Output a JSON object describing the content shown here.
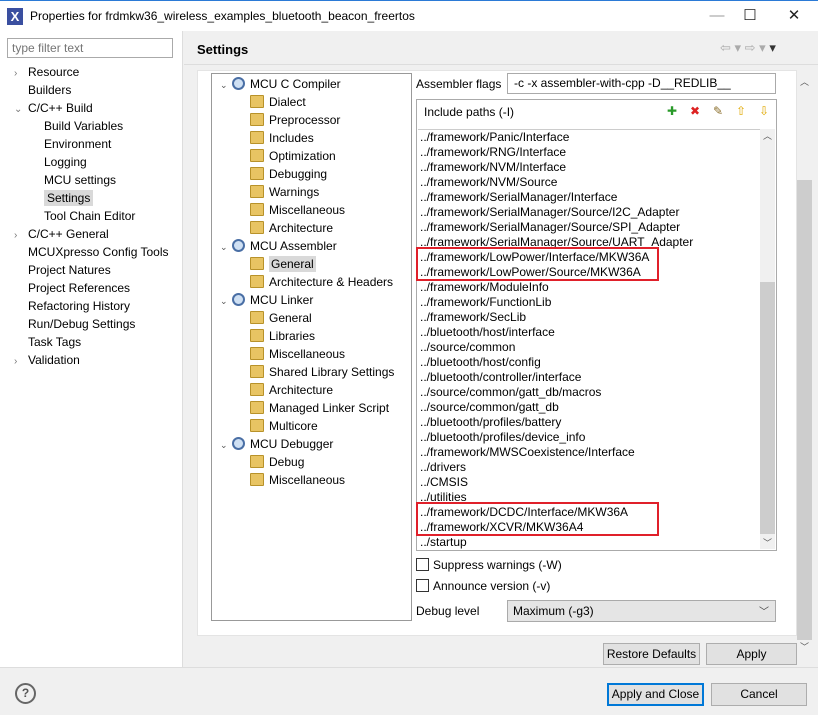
{
  "window": {
    "title": "Properties for frdmkw36_wireless_examples_bluetooth_beacon_freertos",
    "icon": "eclipse-x-icon"
  },
  "filter": {
    "placeholder": "type filter text"
  },
  "nav": [
    {
      "label": "Resource",
      "level": 0,
      "expander": "closed"
    },
    {
      "label": "Builders",
      "level": 0
    },
    {
      "label": "C/C++ Build",
      "level": 0,
      "expander": "open"
    },
    {
      "label": "Build Variables",
      "level": 1
    },
    {
      "label": "Environment",
      "level": 1
    },
    {
      "label": "Logging",
      "level": 1
    },
    {
      "label": "MCU settings",
      "level": 1
    },
    {
      "label": "Settings",
      "level": 1,
      "selected": true
    },
    {
      "label": "Tool Chain Editor",
      "level": 1
    },
    {
      "label": "C/C++ General",
      "level": 0,
      "expander": "closed"
    },
    {
      "label": "MCUXpresso Config Tools",
      "level": 0
    },
    {
      "label": "Project Natures",
      "level": 0
    },
    {
      "label": "Project References",
      "level": 0
    },
    {
      "label": "Refactoring History",
      "level": 0
    },
    {
      "label": "Run/Debug Settings",
      "level": 0
    },
    {
      "label": "Task Tags",
      "level": 0
    },
    {
      "label": "Validation",
      "level": 0,
      "expander": "closed"
    }
  ],
  "page_title": "Settings",
  "tool_tree": [
    {
      "label": "MCU C Compiler",
      "type": "tool"
    },
    {
      "label": "Dialect",
      "type": "option"
    },
    {
      "label": "Preprocessor",
      "type": "option"
    },
    {
      "label": "Includes",
      "type": "option"
    },
    {
      "label": "Optimization",
      "type": "option"
    },
    {
      "label": "Debugging",
      "type": "option"
    },
    {
      "label": "Warnings",
      "type": "option"
    },
    {
      "label": "Miscellaneous",
      "type": "option"
    },
    {
      "label": "Architecture",
      "type": "option"
    },
    {
      "label": "MCU Assembler",
      "type": "tool"
    },
    {
      "label": "General",
      "type": "option",
      "selected": true
    },
    {
      "label": "Architecture & Headers",
      "type": "option"
    },
    {
      "label": "MCU Linker",
      "type": "tool"
    },
    {
      "label": "General",
      "type": "option"
    },
    {
      "label": "Libraries",
      "type": "option"
    },
    {
      "label": "Miscellaneous",
      "type": "option"
    },
    {
      "label": "Shared Library Settings",
      "type": "option"
    },
    {
      "label": "Architecture",
      "type": "option"
    },
    {
      "label": "Managed Linker Script",
      "type": "option"
    },
    {
      "label": "Multicore",
      "type": "option"
    },
    {
      "label": "MCU Debugger",
      "type": "tool"
    },
    {
      "label": "Debug",
      "type": "option"
    },
    {
      "label": "Miscellaneous",
      "type": "option"
    }
  ],
  "assembler_flags": {
    "label": "Assembler flags",
    "value": "-c -x assembler-with-cpp -D__REDLIB__"
  },
  "include_paths": {
    "label": "Include paths (-I)",
    "toolbar": [
      "add-icon",
      "delete-icon",
      "edit-icon",
      "move-up-icon",
      "move-down-icon"
    ],
    "items": [
      "../framework/Panic/Interface",
      "../framework/RNG/Interface",
      "../framework/NVM/Interface",
      "../framework/NVM/Source",
      "../framework/SerialManager/Interface",
      "../framework/SerialManager/Source/I2C_Adapter",
      "../framework/SerialManager/Source/SPI_Adapter",
      "../framework/SerialManager/Source/UART_Adapter",
      "../framework/LowPower/Interface/MKW36A",
      "../framework/LowPower/Source/MKW36A",
      "../framework/ModuleInfo",
      "../framework/FunctionLib",
      "../framework/SecLib",
      "../bluetooth/host/interface",
      "../source/common",
      "../bluetooth/host/config",
      "../bluetooth/controller/interface",
      "../source/common/gatt_db/macros",
      "../source/common/gatt_db",
      "../bluetooth/profiles/battery",
      "../bluetooth/profiles/device_info",
      "../framework/MWSCoexistence/Interface",
      "../drivers",
      "../CMSIS",
      "../utilities",
      "../framework/DCDC/Interface/MKW36A",
      "../framework/XCVR/MKW36A4",
      "../startup"
    ],
    "highlighted": [
      [
        8,
        9
      ],
      [
        25,
        26
      ]
    ],
    "highlight_color": "#e0202a"
  },
  "suppress_warnings": {
    "label": "Suppress warnings (-W)",
    "checked": false
  },
  "announce_version": {
    "label": "Announce version (-v)",
    "checked": false
  },
  "debug_level": {
    "label": "Debug level",
    "value": "Maximum (-g3)"
  },
  "buttons": {
    "restore": "Restore Defaults",
    "apply": "Apply",
    "apply_close": "Apply and Close",
    "cancel": "Cancel",
    "help": "?"
  }
}
